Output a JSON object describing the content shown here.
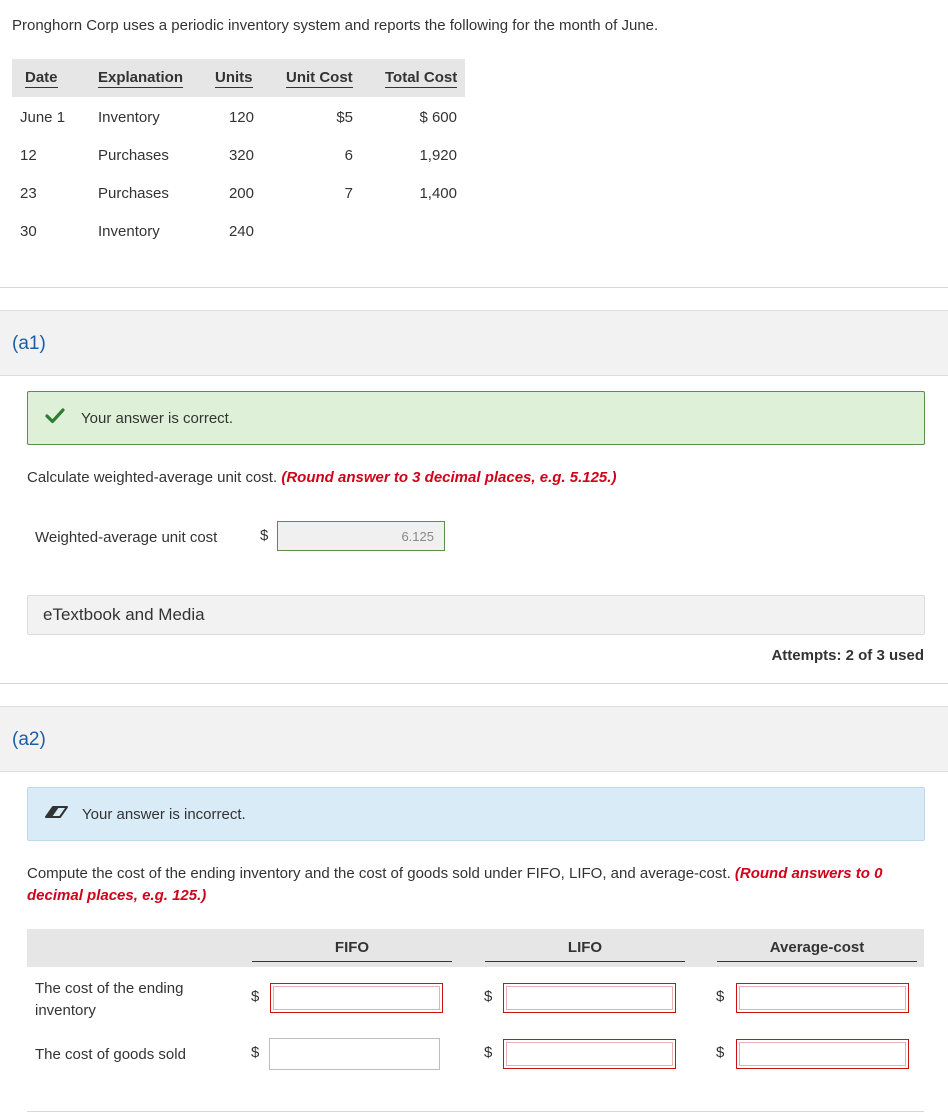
{
  "intro": "Pronghorn Corp uses a periodic inventory system and reports the following for the month of June.",
  "table": {
    "headers": [
      "Date",
      "Explanation",
      "Units",
      "Unit Cost",
      "Total Cost"
    ],
    "rows": [
      [
        "June 1",
        "Inventory",
        "120",
        "$5",
        "$ 600"
      ],
      [
        "12",
        "Purchases",
        "320",
        "6",
        "1,920"
      ],
      [
        "23",
        "Purchases",
        "200",
        "7",
        "1,400"
      ],
      [
        "30",
        "Inventory",
        "240",
        "",
        ""
      ]
    ]
  },
  "a1": {
    "label": "(a1)",
    "feedback": "Your answer is correct.",
    "instruction": "Calculate weighted-average unit cost.",
    "instruction_note": "(Round answer to 3 decimal places, e.g. 5.125.)",
    "field_label": "Weighted-average unit cost",
    "currency": "$",
    "value": "6.125",
    "etextbook": "eTextbook and Media",
    "attempts": "Attempts: 2 of 3 used"
  },
  "a2": {
    "label": "(a2)",
    "feedback": "Your answer is incorrect.",
    "instruction": "Compute the cost of the ending inventory and the cost of goods sold under FIFO, LIFO, and average-cost.",
    "instruction_note_1": "(Round answers to 0",
    "instruction_note_2": "decimal places, e.g. 125.)",
    "columns": [
      "FIFO",
      "LIFO",
      "Average-cost"
    ],
    "row1_label": "The cost of the ending inventory",
    "row2_label": "The cost of goods sold",
    "currency": "$"
  },
  "colors": {
    "accent_blue": "#1a5ea8",
    "correct_green": "#dff0d8",
    "check_green": "#2e7d32",
    "incorrect_blue": "#d9ebf7",
    "note_red": "#d0021b",
    "error_red": "#cc1111"
  }
}
